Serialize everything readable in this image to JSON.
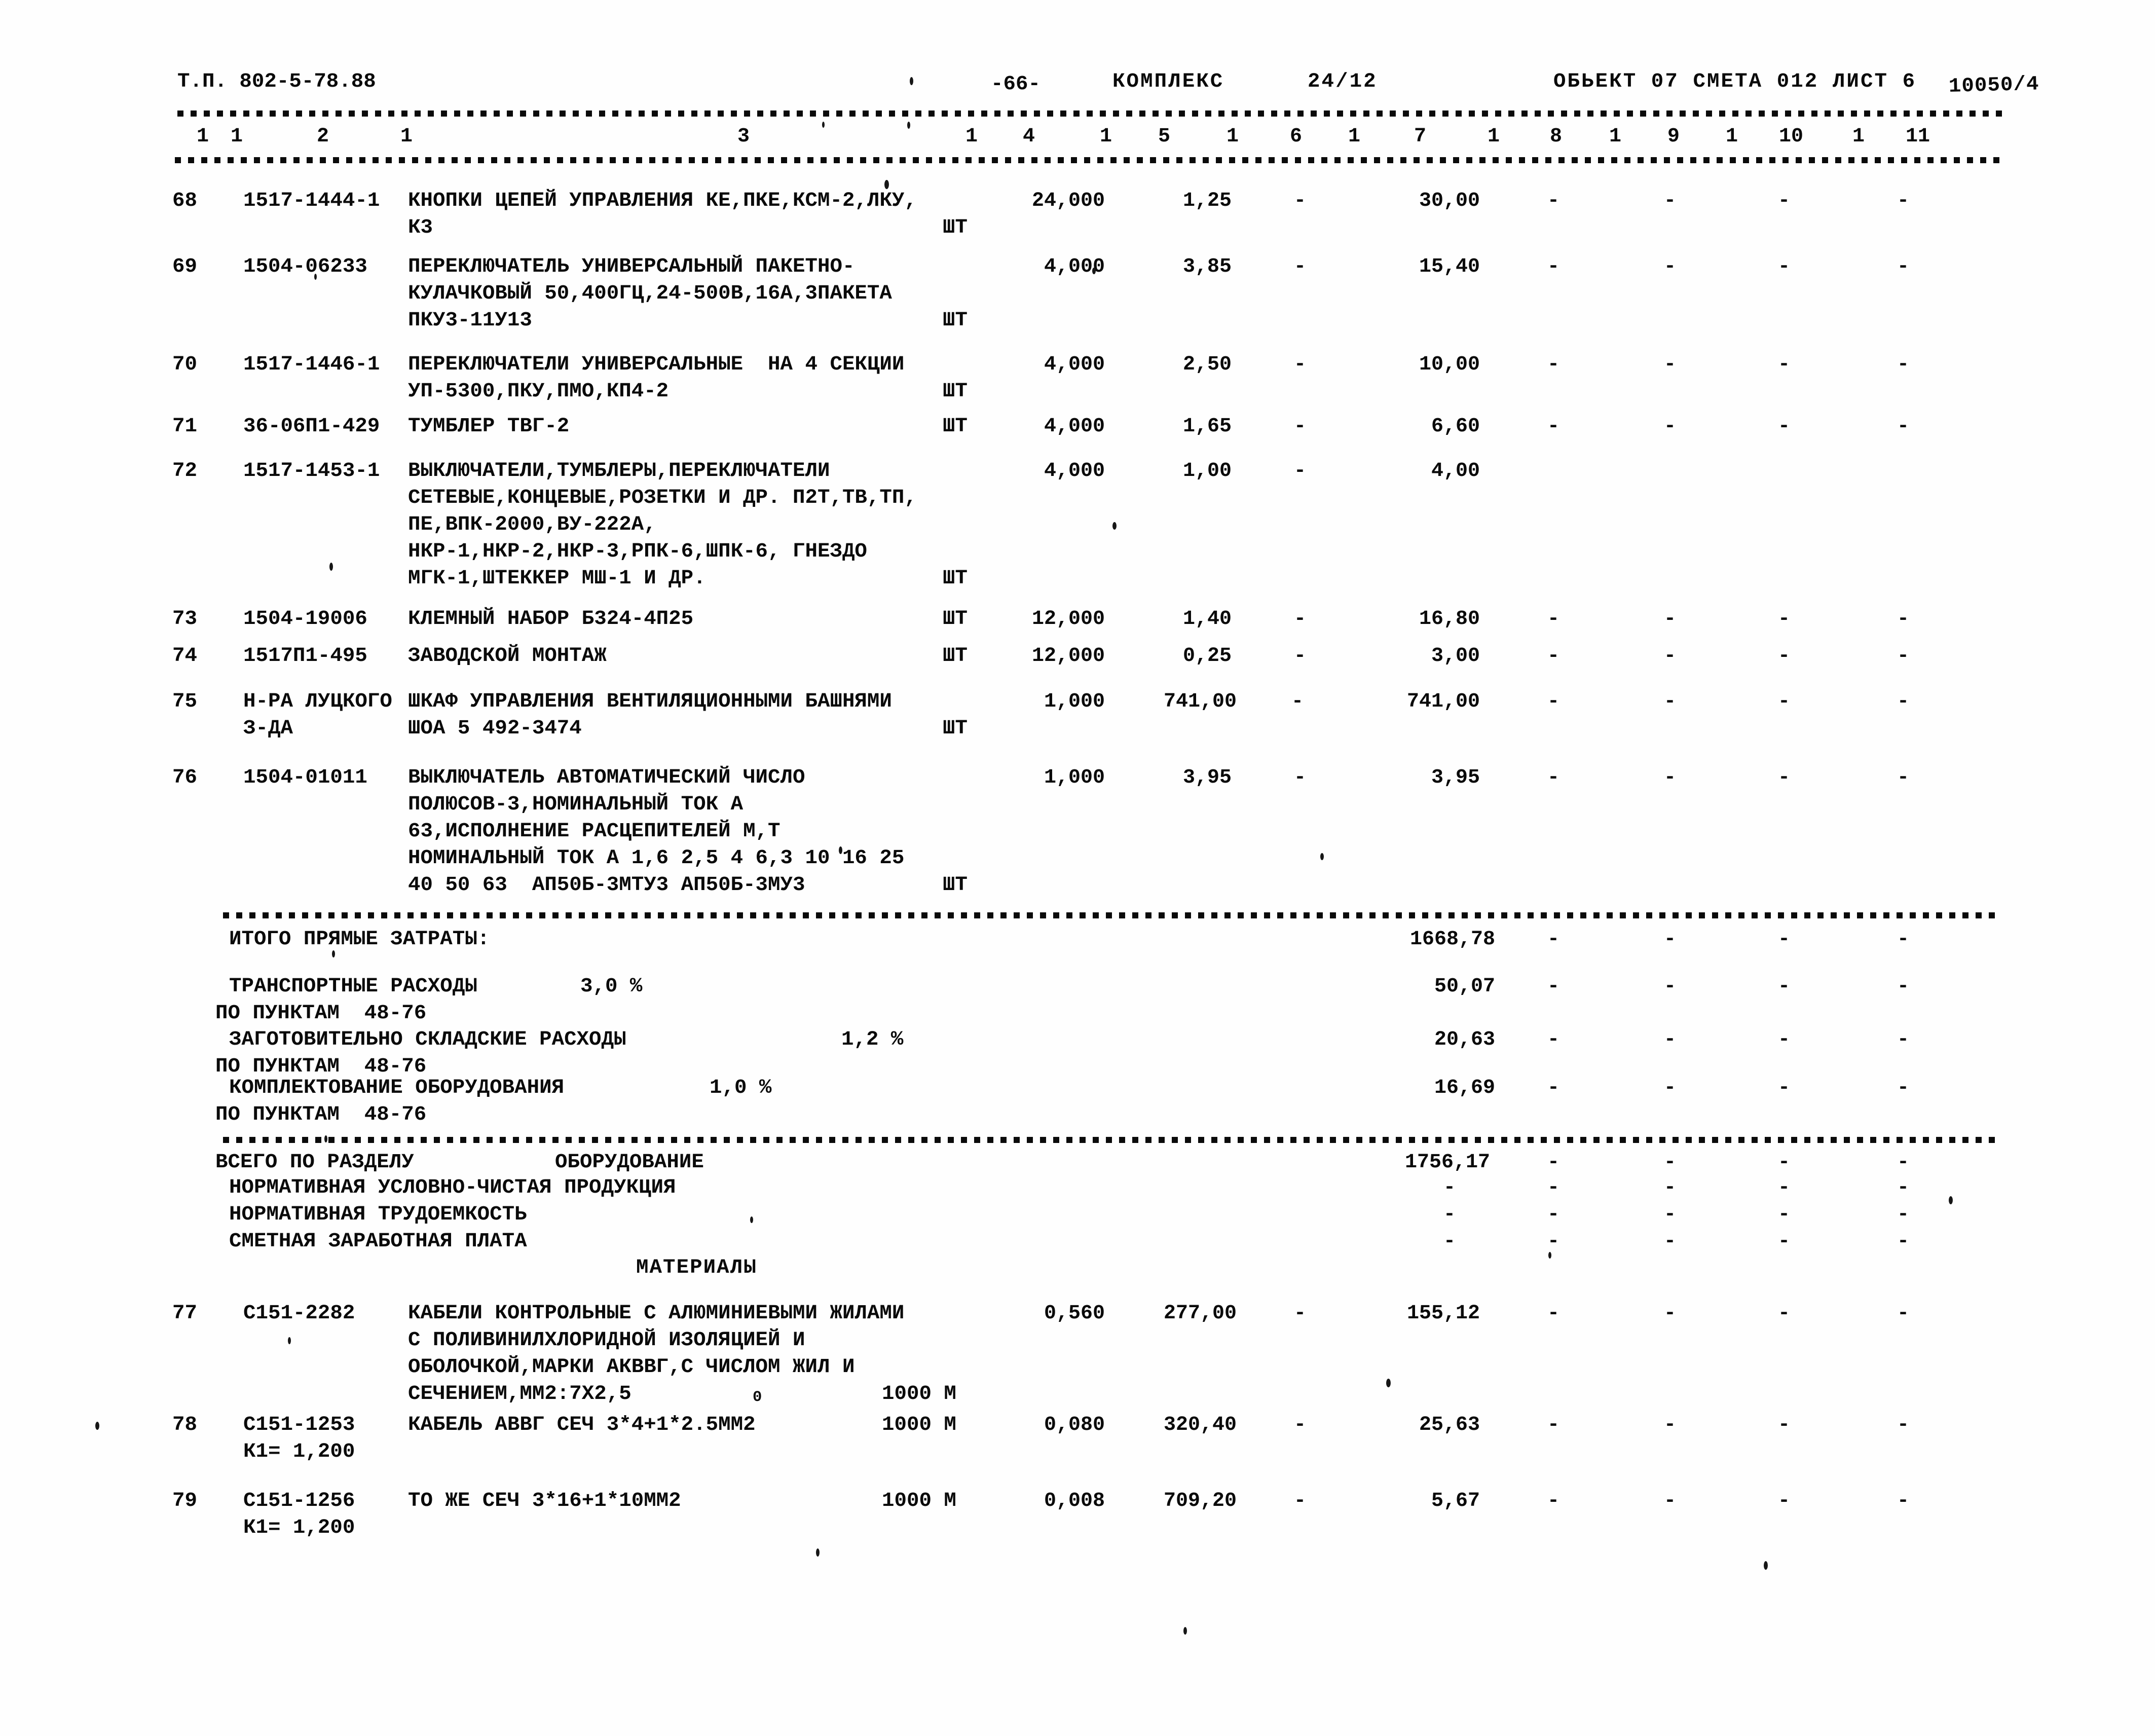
{
  "header": {
    "doc_code": "Т.П. 802-5-78.88",
    "page_number": "-66-",
    "complex_label": "КОМПЛЕКС",
    "complex_value": "24/12",
    "object_line": "ОБЬЕКТ 07 СМЕТА 012 ЛИСТ 6",
    "sheet_code": "10050/4"
  },
  "column_numbers": [
    "1",
    "1",
    "2",
    "1",
    "3",
    "1",
    "4",
    "1",
    "5",
    "1",
    "6",
    "1",
    "7",
    "1",
    "8",
    "1",
    "9",
    "1",
    "10",
    "1",
    "11"
  ],
  "columns": {
    "c1": "1",
    "c2": "2",
    "c3": "3",
    "c4": "4",
    "c5": "5",
    "c6": "6",
    "c7": "7",
    "c8": "8",
    "c9": "9",
    "c10": "10",
    "c11": "11"
  },
  "dash": "-",
  "rows": [
    {
      "no": "68",
      "code": "1517-1444-1",
      "desc": [
        "КНОПКИ ЦЕПЕЙ УПРАВЛЕНИЯ КЕ,ПКЕ,КСМ-2,ЛКУ,",
        "К3"
      ],
      "unit": "ШТ",
      "unit_line": 1,
      "qty": "24,000",
      "price": "1,25",
      "c6": "-",
      "total": "30,00",
      "c8": "-",
      "c9": "-",
      "c10": "-",
      "c11": "-"
    },
    {
      "no": "69",
      "code": "1504-06233",
      "desc": [
        "ПЕРЕКЛЮЧАТЕЛЬ УНИВЕРСАЛЬНЫЙ ПАКЕТНО-",
        "КУЛАЧКОВЫЙ 50,400ГЦ,24-500В,16А,3ПАКЕТА",
        "ПКУ3-11У13"
      ],
      "unit": "ШТ",
      "unit_line": 2,
      "qty": "4,000",
      "price": "3,85",
      "c6": "-",
      "total": "15,40",
      "c8": "-",
      "c9": "-",
      "c10": "-",
      "c11": "-"
    },
    {
      "no": "70",
      "code": "1517-1446-1",
      "desc": [
        "ПЕРЕКЛЮЧАТЕЛИ УНИВЕРСАЛЬНЫЕ  НА 4 СЕКЦИИ",
        "УП-5300,ПКУ,ПМО,КП4-2"
      ],
      "unit": "ШТ",
      "unit_line": 1,
      "qty": "4,000",
      "price": "2,50",
      "c6": "-",
      "total": "10,00",
      "c8": "-",
      "c9": "-",
      "c10": "-",
      "c11": "-"
    },
    {
      "no": "71",
      "code": "36-06П1-429",
      "desc": [
        "ТУМБЛЕР ТВГ-2"
      ],
      "unit": "ШТ",
      "unit_line": 0,
      "qty": "4,000",
      "price": "1,65",
      "c6": "-",
      "total": "6,60",
      "c8": "-",
      "c9": "-",
      "c10": "-",
      "c11": "-"
    },
    {
      "no": "72",
      "code": "1517-1453-1",
      "desc": [
        "ВЫКЛЮЧАТЕЛИ,ТУМБЛЕРЫ,ПЕРЕКЛЮЧАТЕЛИ",
        "СЕТЕВЫЕ,КОНЦЕВЫЕ,РОЗЕТКИ И ДР. П2Т,ТВ,ТП,",
        "ПЕ,ВПК-2000,ВУ-222А,",
        "НКР-1,НКР-2,НКР-3,РПК-6,ШПК-6, ГНЕЗДО",
        "МГК-1,ШТЕККЕР МШ-1 И ДР."
      ],
      "unit": "ШТ",
      "unit_line": 4,
      "qty": "4,000",
      "price": "1,00",
      "c6": "-",
      "total": "4,00",
      "c8": "",
      "c9": "",
      "c10": "",
      "c11": ""
    },
    {
      "no": "73",
      "code": "1504-19006",
      "desc": [
        "КЛЕМНЫЙ НАБОР Б324-4П25"
      ],
      "unit": "ШТ",
      "unit_line": 0,
      "qty": "12,000",
      "price": "1,40",
      "c6": "-",
      "total": "16,80",
      "c8": "-",
      "c9": "-",
      "c10": "-",
      "c11": "-"
    },
    {
      "no": "74",
      "code": "1517П1-495",
      "desc": [
        "ЗАВОДСКОЙ МОНТАЖ"
      ],
      "unit": "ШТ",
      "unit_line": 0,
      "qty": "12,000",
      "price": "0,25",
      "c6": "-",
      "total": "3,00",
      "c8": "-",
      "c9": "-",
      "c10": "-",
      "c11": "-"
    },
    {
      "no": "75",
      "code": "Н-РА ЛУЦКОГО",
      "code2": "З-ДА",
      "desc": [
        "ШКАФ УПРАВЛЕНИЯ ВЕНТИЛЯЦИОННЫМИ БАШНЯМИ",
        "ШОА 5 492-3474"
      ],
      "unit": "ШТ",
      "unit_line": 1,
      "qty": "1,000",
      "price": "741,00",
      "c6": "-",
      "total": "741,00",
      "c8": "-",
      "c9": "-",
      "c10": "-",
      "c11": "-"
    },
    {
      "no": "76",
      "code": "1504-01011",
      "desc": [
        "ВЫКЛЮЧАТЕЛЬ АВТОМАТИЧЕСКИЙ ЧИСЛО",
        "ПОЛЮСОВ-3,НОМИНАЛЬНЫЙ ТОК А",
        "63,ИСПОЛНЕНИЕ РАСЦЕПИТЕЛЕЙ М,Т",
        "НОМИНАЛЬНЫЙ ТОК А 1,6 2,5 4 6,3 10 16 25",
        "40 50 63  АП50Б-3МТУ3 АП50Б-3МУ3"
      ],
      "unit": "ШТ",
      "unit_line": 4,
      "qty": "1,000",
      "price": "3,95",
      "c6": "-",
      "total": "3,95",
      "c8": "-",
      "c9": "-",
      "c10": "-",
      "c11": "-"
    }
  ],
  "totals": {
    "direct_costs_label": "ИТОГО ПРЯМЫЕ ЗАТРАТЫ:",
    "direct_costs_value": "1668,78",
    "transport_label": "ТРАНСПОРТНЫЕ РАСХОДЫ",
    "transport_percent": "3,0 %",
    "transport_items": "ПО ПУНКТАМ  48-76",
    "transport_value": "50,07",
    "storage_label": "ЗАГОТОВИТЕЛЬНО СКЛАДСКИЕ РАСХОДЫ",
    "storage_percent": "1,2 %",
    "storage_items": "ПО ПУНКТАМ  48-76",
    "storage_value": "20,63",
    "equip_label": "КОМПЛЕКТОВАНИЕ ОБОРУДОВАНИЯ",
    "equip_percent": "1,0 %",
    "equip_items": "ПО ПУНКТАМ  48-76",
    "equip_value": "16,69"
  },
  "section_total": {
    "label": "ВСЕГО ПО РАЗДЕЛУ",
    "name": "ОБОРУДОВАНИЕ",
    "value": "1756,17",
    "lines": [
      "НОРМАТИВНАЯ УСЛОВНО-ЧИСТАЯ ПРОДУКЦИЯ",
      "НОРМАТИВНАЯ ТРУДОЕМКОСТЬ",
      "СМЕТНАЯ ЗАРАБОТНАЯ ПЛАТА"
    ]
  },
  "materials": {
    "title": "МАТЕРИАЛЫ",
    "rows": [
      {
        "no": "77",
        "code": "С151-2282",
        "desc": [
          "КАБЕЛИ КОНТРОЛЬНЫЕ С АЛЮМИНИЕВЫМИ ЖИЛАМИ",
          "С ПОЛИВИНИЛХЛОРИДНОЙ ИЗОЛЯЦИЕЙ И",
          "ОБОЛОЧКОЙ,МАРКИ АКВВГ,С ЧИСЛОМ ЖИЛ И",
          "СЕЧЕНИЕМ,ММ2:7Х2,5"
        ],
        "stray": "0",
        "unit": "1000 М",
        "unit_line": 3,
        "qty": "0,560",
        "price": "277,00",
        "c6": "-",
        "total": "155,12",
        "c8": "-",
        "c9": "-",
        "c10": "-",
        "c11": "-"
      },
      {
        "no": "78",
        "code": "С151-1253",
        "code2": "К1= 1,200",
        "desc": [
          "КАБЕЛЬ АВВГ СЕЧ 3*4+1*2.5ММ2"
        ],
        "unit": "1000 М",
        "unit_line": 0,
        "unit_inline": true,
        "qty": "0,080",
        "price": "320,40",
        "c6": "-",
        "total": "25,63",
        "c8": "-",
        "c9": "-",
        "c10": "-",
        "c11": "-"
      },
      {
        "no": "79",
        "code": "С151-1256",
        "code2": "К1= 1,200",
        "desc": [
          "ТО ЖЕ СЕЧ 3*16+1*10ММ2"
        ],
        "unit": "1000 М",
        "unit_line": 0,
        "unit_inline": true,
        "qty": "0,008",
        "price": "709,20",
        "c6": "-",
        "total": "5,67",
        "c8": "-",
        "c9": "-",
        "c10": "-",
        "c11": "-"
      }
    ]
  }
}
